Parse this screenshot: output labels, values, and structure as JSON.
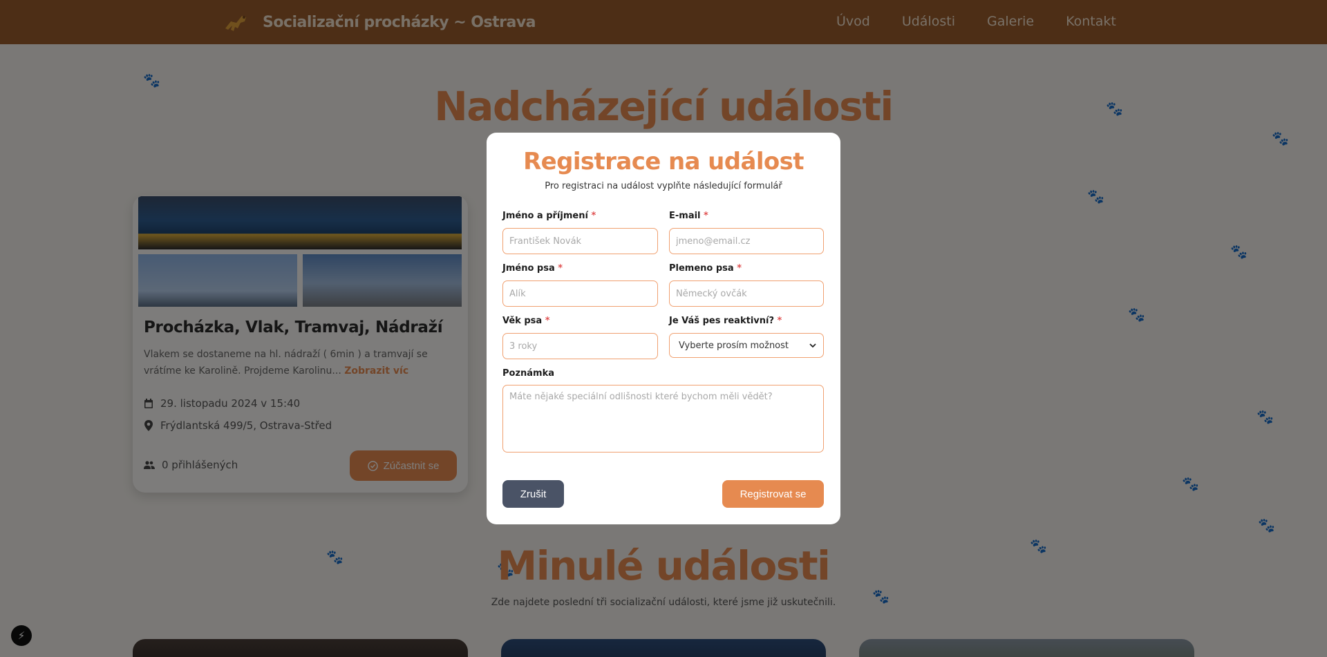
{
  "header": {
    "site_title": "Socializační procházky ~ Ostrava",
    "nav": [
      "Úvod",
      "Události",
      "Galerie",
      "Kontakt"
    ]
  },
  "upcoming": {
    "title": "Nadcházející události",
    "event": {
      "title": "Procházka, Vlak, Tramvaj, Nádraží",
      "description": "Vlakem se dostaneme na hl. nádraží ( 6min ) a tramvají se vrátíme ke Karolině. Projdeme Karolinu...",
      "more_link": "Zobrazit víc",
      "date": "29. listopadu 2024 v 15:40",
      "location": "Frýdlantská 499/5, Ostrava-Střed",
      "attendees": "0 přihlášených",
      "join_label": "Zúčastnit se"
    }
  },
  "past": {
    "title": "Minulé události",
    "subtitle": "Zde najdete poslední tři socializační události, které jsme již uskutečnili."
  },
  "modal": {
    "title": "Registrace na událost",
    "subtitle": "Pro registraci na událost vyplňte následující formulář",
    "fields": {
      "name": {
        "label": "Jméno a příjmení",
        "placeholder": "František Novák",
        "required": "*"
      },
      "email": {
        "label": "E-mail",
        "placeholder": "jmeno@email.cz",
        "required": "*"
      },
      "dog_name": {
        "label": "Jméno psa",
        "placeholder": "Alík",
        "required": "*"
      },
      "breed": {
        "label": "Plemeno psa",
        "placeholder": "Německý ovčák",
        "required": "*"
      },
      "age": {
        "label": "Věk psa",
        "placeholder": "3 roky",
        "required": "*"
      },
      "reactive": {
        "label": "Je Váš pes reaktivní?",
        "selected": "Vyberte prosím možnost",
        "required": "*"
      },
      "note": {
        "label": "Poznámka",
        "placeholder": "Máte nějaké speciální odlišnosti které bychom měli vědět?"
      }
    },
    "cancel_label": "Zrušit",
    "submit_label": "Registrovat se"
  },
  "colors": {
    "header_bg": "#9a5c2c",
    "accent": "#e68a50",
    "cancel_bg": "#4a5366"
  }
}
